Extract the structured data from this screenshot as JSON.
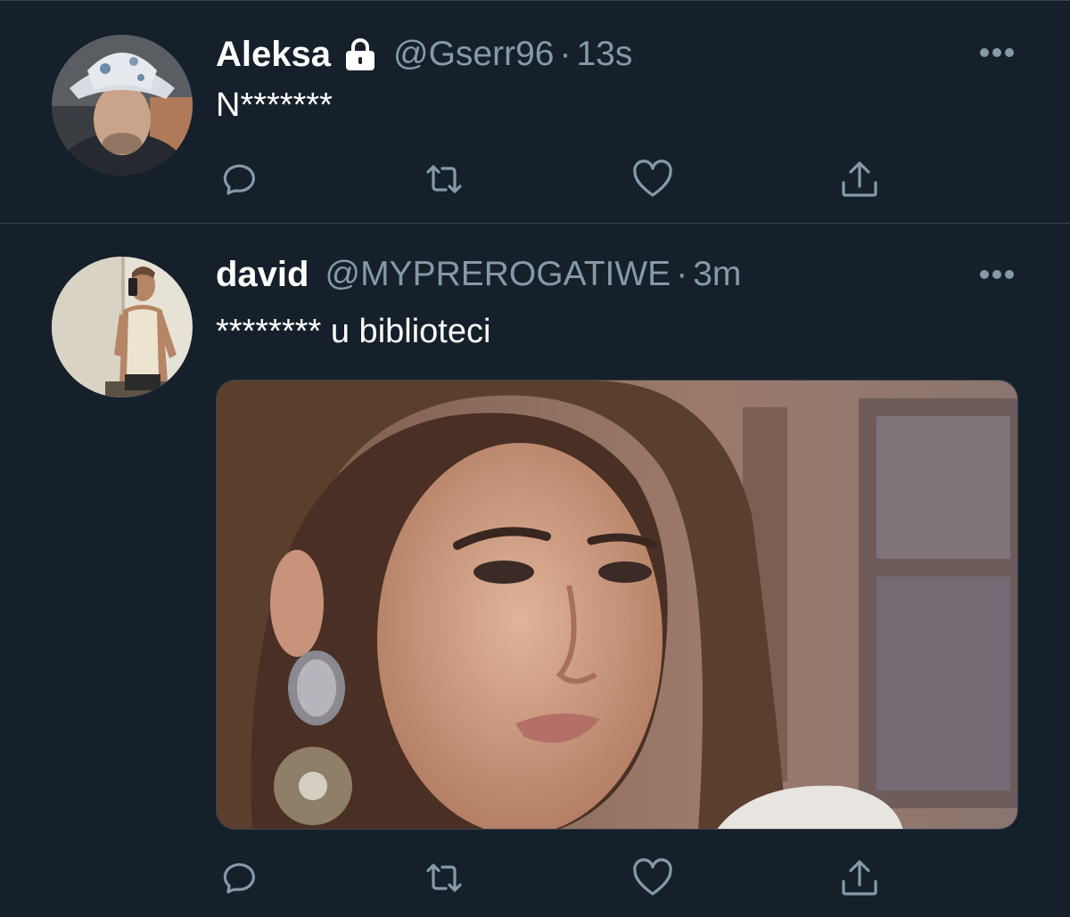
{
  "tweets": [
    {
      "display_name": "Aleksa",
      "protected": true,
      "handle": "@Gserr96",
      "separator": "·",
      "time": "13s",
      "text": "N*******",
      "avatar_icon": "person-in-bucket-hat-avatar"
    },
    {
      "display_name": "david",
      "protected": false,
      "handle": "@MYPREROGATIWE",
      "separator": "·",
      "time": "3m",
      "text": "******** u biblioteci",
      "avatar_icon": "person-mirror-selfie-avatar",
      "media": "photo-woman-with-earring"
    }
  ],
  "actions": [
    "reply-icon",
    "retweet-icon",
    "like-icon",
    "share-icon"
  ],
  "colors": {
    "background": "#15202b",
    "divider": "#38444d",
    "secondary_text": "#8899a6",
    "primary_text": "#ffffff"
  }
}
